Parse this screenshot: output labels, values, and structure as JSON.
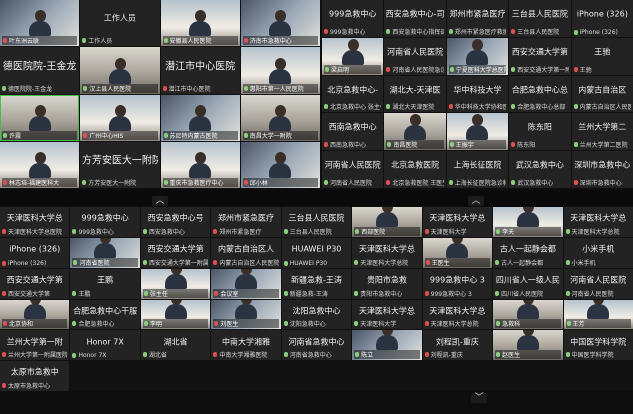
{
  "panel1": {
    "tiles": [
      {
        "name": "",
        "label": "叶东洲云联",
        "video": true,
        "v": "v3"
      },
      {
        "name": "工作人员",
        "label": "工作人员",
        "video": false
      },
      {
        "name": "",
        "label": "安徽县人民医院",
        "video": true,
        "v": "v4"
      },
      {
        "name": "",
        "label": "济南市急救中心",
        "video": true,
        "v": "v3"
      },
      {
        "name": "德医院院-王金龙",
        "label": "德医院院-王金龙",
        "video": false,
        "big": true
      },
      {
        "name": "",
        "label": "汉上县人民医院",
        "video": true,
        "v": "v2"
      },
      {
        "name": "潜江市中心医院",
        "label": "潜江市中心医院",
        "video": false,
        "big": true
      },
      {
        "name": "",
        "label": "惠阳市第一人民医院",
        "video": true,
        "v": "v4"
      },
      {
        "name": "",
        "label": "许震",
        "video": true,
        "v": "v2",
        "speaking": true
      },
      {
        "name": "",
        "label": "广州中心HIS",
        "video": true,
        "v": "v4"
      },
      {
        "name": "",
        "label": "苏尼特内蒙古医院",
        "video": true,
        "v": "v3"
      },
      {
        "name": "",
        "label": "南昌大学一附院",
        "video": true,
        "v": "v2"
      },
      {
        "name": "",
        "label": "林志培-福建医科大",
        "video": true,
        "v": "v4"
      },
      {
        "name": "方芳安医大一附院",
        "label": "方芳安医大一附院",
        "video": false,
        "big": true
      },
      {
        "name": "",
        "label": "重庆市急救医疗中心",
        "video": true,
        "v": "v4"
      },
      {
        "name": "",
        "label": "邱小林",
        "video": true,
        "v": "v3"
      }
    ]
  },
  "panel2": {
    "tiles": [
      {
        "name": "999急救中心",
        "label": "999急救中心",
        "video": false
      },
      {
        "name": "西安急救中心-司",
        "label": "西安急救中心指挥调度",
        "video": false
      },
      {
        "name": "郑州市紧急医疗",
        "label": "郑州市紧急医疗救援中心",
        "video": false
      },
      {
        "name": "三台县人民医院",
        "label": "三台县人民医院",
        "video": false
      },
      {
        "name": "iPhone (326)",
        "label": "iPhone (326)",
        "video": false
      },
      {
        "name": "",
        "label": "梁启明",
        "video": true,
        "v": "v4"
      },
      {
        "name": "河南省人民医院",
        "label": "河南省人民医院急诊",
        "video": false
      },
      {
        "name": "",
        "label": "宁夏医科大学总医院",
        "video": true,
        "v": "v3"
      },
      {
        "name": "西安交通大学第",
        "label": "西安交通大学第一附属医院",
        "video": false
      },
      {
        "name": "王驰",
        "label": "王驰",
        "video": false
      },
      {
        "name": "北京急救中心-",
        "label": "北京急救中心 张主任",
        "video": false
      },
      {
        "name": "湖北大-天津医",
        "label": "湖北大天津医院",
        "video": false
      },
      {
        "name": "华中科技大学",
        "label": "华中科技大学协和医院",
        "video": false
      },
      {
        "name": "合肥急救中心总",
        "label": "合肥急救中心总部",
        "video": false
      },
      {
        "name": "内蒙古自治区",
        "label": "内蒙古自治区人民医院",
        "video": false
      },
      {
        "name": "西南急救中心",
        "label": "西南急救中心",
        "video": false
      },
      {
        "name": "",
        "label": "南昌医院",
        "video": true,
        "v": "v2"
      },
      {
        "name": "",
        "label": "王振宇",
        "video": true,
        "v": "v4"
      },
      {
        "name": "陈东阳",
        "label": "陈东阳",
        "video": false
      },
      {
        "name": "兰州大学第二",
        "label": "兰州大学第二医院",
        "video": false
      },
      {
        "name": "河南省人民医院",
        "label": "河南省人民医院",
        "video": false
      },
      {
        "name": "北京急救医院",
        "label": "北京急救医院 王医生",
        "video": false
      },
      {
        "name": "上海长征医院",
        "label": "上海长征医院急诊科",
        "video": false
      },
      {
        "name": "武汉急救中心",
        "label": "武汉急救中心",
        "video": false
      },
      {
        "name": "深圳市急救中心",
        "label": "深圳市急救中心",
        "video": false
      }
    ]
  },
  "panel3": {
    "tiles": [
      {
        "name": "天津医科大学总",
        "label": "天津医科大学总医院",
        "video": false
      },
      {
        "name": "999急救中心",
        "label": "999急救中心",
        "video": false
      },
      {
        "name": "西安急救中心号",
        "label": "西安急救中心",
        "video": false
      },
      {
        "name": "郑州市紧急医疗",
        "label": "郑州市紧急医疗",
        "video": false
      },
      {
        "name": "三台县人民医院",
        "label": "三台县人民医院",
        "video": false
      },
      {
        "name": "",
        "label": "西部医院",
        "video": true,
        "v": "v2"
      },
      {
        "name": "天津医科大学总",
        "label": "天津医科大学",
        "video": false
      },
      {
        "name": "",
        "label": "李天",
        "video": true,
        "v": "v4"
      },
      {
        "name": "天津医科大学总",
        "label": "天津医科大学总院",
        "video": false
      },
      {
        "name": "iPhone (326)",
        "label": "iPhone (326)",
        "video": false
      },
      {
        "name": "",
        "label": "河南省医院",
        "video": true,
        "v": "v3"
      },
      {
        "name": "西安交通大学第",
        "label": "西安交通大学第一附属",
        "video": false
      },
      {
        "name": "内蒙古自治区人",
        "label": "内蒙古自治区人民医院",
        "video": false
      },
      {
        "name": "HUAWEI P30",
        "label": "HUAWEI P30",
        "video": false
      },
      {
        "name": "天津医科大学总",
        "label": "天津医科大学总院",
        "video": false
      },
      {
        "name": "",
        "label": "王医生",
        "video": true,
        "v": "v2"
      },
      {
        "name": "古人一起静会都",
        "label": "古人一起静会都",
        "video": false
      },
      {
        "name": "小米手机",
        "label": "小米手机",
        "video": false
      },
      {
        "name": "西安交通大学第",
        "label": "西安交通大学第",
        "video": false
      },
      {
        "name": "王鹏",
        "label": "王鹏",
        "video": false
      },
      {
        "name": "",
        "label": "张主任",
        "video": true,
        "v": "v4"
      },
      {
        "name": "",
        "label": "会议室",
        "video": true,
        "v": "v3"
      },
      {
        "name": "新疆急救-王涛",
        "label": "新疆急救-王涛",
        "video": false
      },
      {
        "name": "贵阳市急救",
        "label": "贵阳市急救中心",
        "video": false
      },
      {
        "name": "999急救中心 3",
        "label": "999急救中心 3",
        "video": false
      },
      {
        "name": "四川省人一级人民",
        "label": "四川省人民医院",
        "video": false
      },
      {
        "name": "河南省人民医院",
        "label": "河南省人民医院",
        "video": false
      },
      {
        "name": "",
        "label": "北京协和",
        "video": true,
        "v": "v2"
      },
      {
        "name": "合肥急救中心干服",
        "label": "合肥急救中心",
        "video": false
      },
      {
        "name": "",
        "label": "李明",
        "video": true,
        "v": "v4"
      },
      {
        "name": "",
        "label": "刘医生",
        "video": true,
        "v": "v3"
      },
      {
        "name": "沈阳急救中心",
        "label": "沈阳急救中心",
        "video": false
      },
      {
        "name": "天津医科大学总",
        "label": "天津医科大学",
        "video": false
      },
      {
        "name": "天津医科大学总",
        "label": "天津医科大学总院",
        "video": false
      },
      {
        "name": "",
        "label": "急救科",
        "video": true,
        "v": "v2"
      },
      {
        "name": "",
        "label": "王芳",
        "video": true,
        "v": "v4"
      },
      {
        "name": "兰州大学第一附",
        "label": "兰州大学第一附属医院",
        "video": false
      },
      {
        "name": "Honor 7X",
        "label": "Honor 7X",
        "video": false
      },
      {
        "name": "湖北省",
        "label": "湖北省",
        "video": false
      },
      {
        "name": "中南大学湘雅",
        "label": "中南大学湘雅医院",
        "video": false
      },
      {
        "name": "河南省急救中心",
        "label": "河南省急救中心",
        "video": false
      },
      {
        "name": "",
        "label": "陈立",
        "video": true,
        "v": "v3"
      },
      {
        "name": "刘程凯-重庆",
        "label": "刘程凯-重庆",
        "video": false
      },
      {
        "name": "",
        "label": "赵医生",
        "video": true,
        "v": "v2"
      },
      {
        "name": "中国医学科学院",
        "label": "中国医学科学院",
        "video": false
      },
      {
        "name": "太原市急救中",
        "label": "太原市急救中心",
        "video": false
      }
    ]
  },
  "chevrons": {
    "up1": "︿",
    "up2": "︿",
    "down": "﹀"
  }
}
